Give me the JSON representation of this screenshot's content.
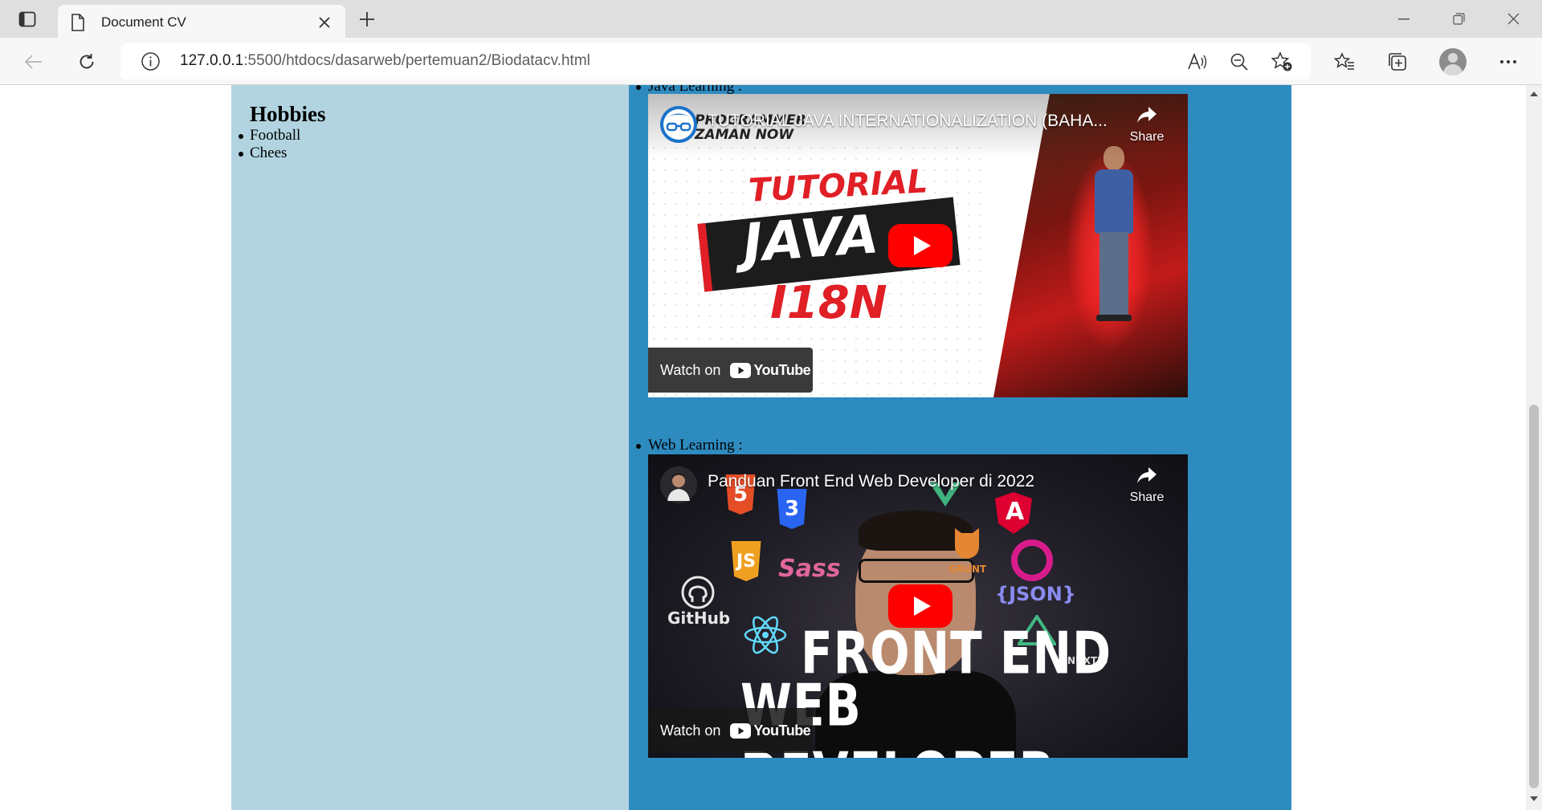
{
  "browser": {
    "tab_title": "Document CV",
    "url_host": "127.0.0.1",
    "url_path": ":5500/htdocs/dasarweb/pertemuan2/Biodatacv.html"
  },
  "icons": {
    "tab_actions": "tab-actions-icon",
    "page": "page-icon",
    "close": "close-icon",
    "new_tab": "plus-icon",
    "minimize": "minimize-icon",
    "restore": "restore-icon",
    "window_close": "close-icon",
    "back": "back-arrow-icon",
    "refresh": "refresh-icon",
    "info": "info-icon",
    "read_aloud": "read-aloud-icon",
    "zoom_out": "zoom-out-icon",
    "add_favorite": "star-plus-icon",
    "favorites": "favorites-icon",
    "collections": "collections-icon",
    "profile": "profile-icon",
    "more": "more-icon"
  },
  "page": {
    "hobbies": {
      "title": "Hobbies",
      "items": [
        "Football",
        "Chees"
      ]
    },
    "learning": [
      {
        "label": "Java Learning :",
        "video": {
          "title": "TUTORIAL JAVA INTERNATIONALIZATION (BAHA...",
          "channel_brand_line1": "PROGRAMMER",
          "channel_brand_line2": "ZAMAN NOW",
          "thumb_line1": "TUTORIAL",
          "thumb_line2": "JAVA",
          "thumb_line3": "I18N",
          "share_label": "Share",
          "watch_on": "Watch on",
          "youtube": "YouTube"
        }
      },
      {
        "label": "Web Learning :",
        "video": {
          "title": "Panduan Front End Web Developer di 2022",
          "thumb_line1": "FRONT END",
          "thumb_line2": "WEB DEVELOPER",
          "tech_labels": [
            "5",
            "3",
            "JS",
            "Sass",
            "GitHub",
            "{JSON}",
            "GRUNT",
            "NUXTJS",
            "A"
          ],
          "share_label": "Share",
          "watch_on": "Watch on",
          "youtube": "YouTube"
        }
      }
    ]
  },
  "colors": {
    "sidebar_bg": "#b1d4e0",
    "main_bg": "#2e8bc0",
    "youtube_red": "#ff0000"
  }
}
